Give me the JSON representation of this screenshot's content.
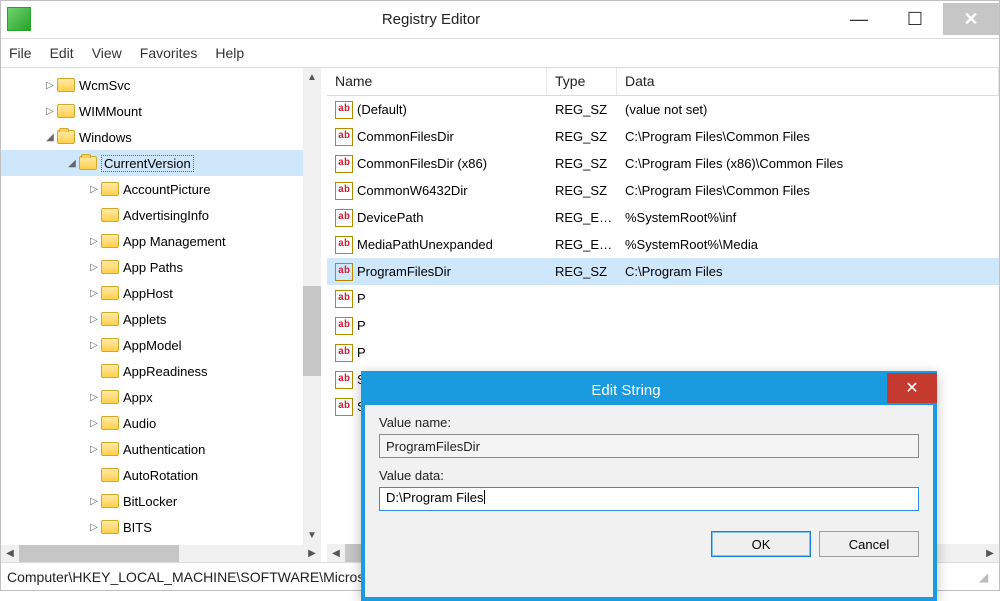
{
  "window": {
    "title": "Registry Editor",
    "menu": [
      "File",
      "Edit",
      "View",
      "Favorites",
      "Help"
    ]
  },
  "tree": {
    "items": [
      {
        "label": "WcmSvc",
        "indent": 1,
        "tw": "▷",
        "sel": false
      },
      {
        "label": "WIMMount",
        "indent": 1,
        "tw": "▷",
        "sel": false
      },
      {
        "label": "Windows",
        "indent": 1,
        "tw": "◢",
        "sel": false
      },
      {
        "label": "CurrentVersion",
        "indent": 2,
        "tw": "◢",
        "sel": true
      },
      {
        "label": "AccountPicture",
        "indent": 3,
        "tw": "▷",
        "sel": false
      },
      {
        "label": "AdvertisingInfo",
        "indent": 3,
        "tw": "",
        "sel": false
      },
      {
        "label": "App Management",
        "indent": 3,
        "tw": "▷",
        "sel": false
      },
      {
        "label": "App Paths",
        "indent": 3,
        "tw": "▷",
        "sel": false
      },
      {
        "label": "AppHost",
        "indent": 3,
        "tw": "▷",
        "sel": false
      },
      {
        "label": "Applets",
        "indent": 3,
        "tw": "▷",
        "sel": false
      },
      {
        "label": "AppModel",
        "indent": 3,
        "tw": "▷",
        "sel": false
      },
      {
        "label": "AppReadiness",
        "indent": 3,
        "tw": "",
        "sel": false
      },
      {
        "label": "Appx",
        "indent": 3,
        "tw": "▷",
        "sel": false
      },
      {
        "label": "Audio",
        "indent": 3,
        "tw": "▷",
        "sel": false
      },
      {
        "label": "Authentication",
        "indent": 3,
        "tw": "▷",
        "sel": false
      },
      {
        "label": "AutoRotation",
        "indent": 3,
        "tw": "",
        "sel": false
      },
      {
        "label": "BitLocker",
        "indent": 3,
        "tw": "▷",
        "sel": false
      },
      {
        "label": "BITS",
        "indent": 3,
        "tw": "▷",
        "sel": false
      }
    ]
  },
  "list": {
    "headers": {
      "name": "Name",
      "type": "Type",
      "data": "Data"
    },
    "rows": [
      {
        "name": "(Default)",
        "type": "REG_SZ",
        "data": "(value not set)",
        "sel": false
      },
      {
        "name": "CommonFilesDir",
        "type": "REG_SZ",
        "data": "C:\\Program Files\\Common Files",
        "sel": false
      },
      {
        "name": "CommonFilesDir (x86)",
        "type": "REG_SZ",
        "data": "C:\\Program Files (x86)\\Common Files",
        "sel": false
      },
      {
        "name": "CommonW6432Dir",
        "type": "REG_SZ",
        "data": "C:\\Program Files\\Common Files",
        "sel": false
      },
      {
        "name": "DevicePath",
        "type": "REG_E…",
        "data": "%SystemRoot%\\inf",
        "sel": false
      },
      {
        "name": "MediaPathUnexpanded",
        "type": "REG_E…",
        "data": "%SystemRoot%\\Media",
        "sel": false
      },
      {
        "name": "ProgramFilesDir",
        "type": "REG_SZ",
        "data": "C:\\Program Files",
        "sel": true
      },
      {
        "name": "P",
        "type": "",
        "data": "",
        "sel": false
      },
      {
        "name": "P",
        "type": "",
        "data": "",
        "sel": false
      },
      {
        "name": "P",
        "type": "",
        "data": "",
        "sel": false
      },
      {
        "name": "S",
        "type": "",
        "data": "",
        "sel": false
      },
      {
        "name": "S",
        "type": "",
        "data": "",
        "sel": false
      }
    ]
  },
  "dialog": {
    "title": "Edit String",
    "valueNameLabel": "Value name:",
    "valueName": "ProgramFilesDir",
    "valueDataLabel": "Value data:",
    "valueData": "D:\\Program Files",
    "ok": "OK",
    "cancel": "Cancel"
  },
  "statusbar": "Computer\\HKEY_LOCAL_MACHINE\\SOFTWARE\\Microsoft\\Windows\\CurrentVersion"
}
